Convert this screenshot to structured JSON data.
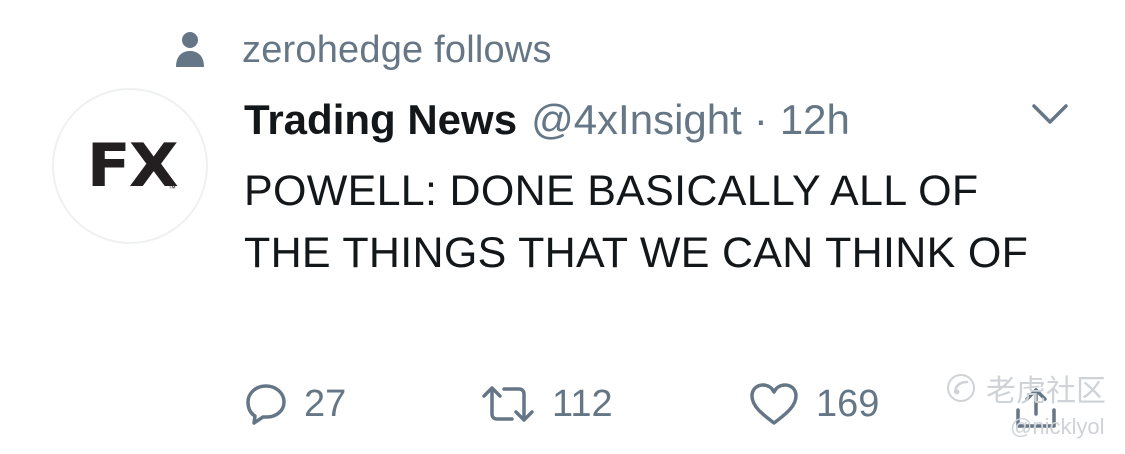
{
  "social_context": {
    "text": "zerohedge follows",
    "icon": "person-icon"
  },
  "tweet": {
    "avatar": {
      "logo_text": "FX",
      "logo_mark": "™"
    },
    "display_name": "Trading News",
    "handle": "@4xInsight",
    "separator": "·",
    "timestamp": "12h",
    "caret_icon": "chevron-down-icon",
    "text": "POWELL: DONE BASICALLY ALL OF THE THINGS THAT WE CAN THINK OF",
    "actions": {
      "reply": {
        "icon": "reply-icon",
        "count": "27"
      },
      "retweet": {
        "icon": "retweet-icon",
        "count": "112"
      },
      "like": {
        "icon": "heart-icon",
        "count": "169"
      },
      "share": {
        "icon": "share-icon"
      }
    }
  },
  "watermark": {
    "line1": "老虎社区",
    "line2": "@nicklyol"
  },
  "colors": {
    "text_primary": "#14171a",
    "text_secondary": "#657786",
    "watermark": "#cfd3d7"
  }
}
